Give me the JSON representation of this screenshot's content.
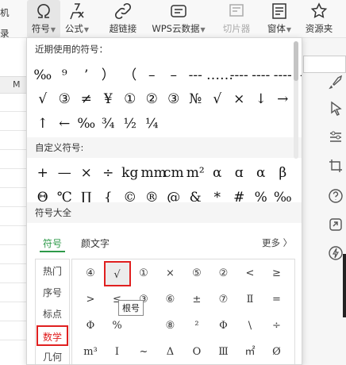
{
  "ribbon": {
    "left_partial_label_1": "机",
    "left_partial_label_2": "录",
    "symbol_button": "符号",
    "formula_button": "公式",
    "hyperlink_button": "超链接",
    "wps_cloud_button": "WPS云数据",
    "slicer_button": "切片器",
    "window_button": "窗体",
    "resource_button": "资源夹"
  },
  "sheet": {
    "column_header": "M"
  },
  "panel": {
    "recent_title": "近期使用的符号：",
    "recent_rows": [
      [
        "‰",
        "⁹",
        "’",
        "）",
        "（",
        "–",
        "–",
        "---",
        "……",
        "----",
        "----",
        "----",
        "--"
      ],
      [
        "√",
        "③",
        "≠",
        "¥",
        "①",
        "②",
        "③",
        "№",
        "√",
        "×",
        "↓",
        "→"
      ],
      [
        "↑",
        "←",
        "‰",
        "¾",
        "½",
        "¼"
      ]
    ],
    "custom_title": "自定义符号:",
    "custom_rows": [
      [
        "+",
        "—",
        "×",
        "÷",
        "kg",
        "mm",
        "cm",
        "m²",
        "α",
        "ɑ",
        "α",
        "β"
      ],
      [
        "Θ",
        "℃",
        "∏",
        "{",
        "©",
        "®",
        "@",
        "&",
        "*",
        "#",
        "%",
        "‰"
      ]
    ],
    "all_title": "符号大全",
    "tabs": [
      "符号",
      "颜文字"
    ],
    "more_label": "更多 〉",
    "categories": [
      "热门",
      "序号",
      "标点",
      "数学",
      "几何"
    ],
    "selected_category": "数学",
    "grid_rows": [
      [
        "④",
        "√",
        "①",
        "×",
        "⑤",
        "②",
        "<",
        "≥"
      ],
      [
        ">",
        "≤",
        "③",
        "⑥",
        "±",
        "⑦",
        "Ⅱ",
        "="
      ],
      [
        "Φ",
        "%",
        "",
        "⑧",
        "²",
        "Φ",
        "\\",
        "÷"
      ],
      [
        "m³",
        "Ⅰ",
        "~",
        "Δ",
        "Ο",
        "Ⅲ",
        "㎡",
        "Ø"
      ]
    ],
    "highlighted_symbol": "√",
    "tooltip": "根号"
  },
  "colors": {
    "accent_green": "#2e9a4a",
    "highlight_red": "#e02020"
  }
}
